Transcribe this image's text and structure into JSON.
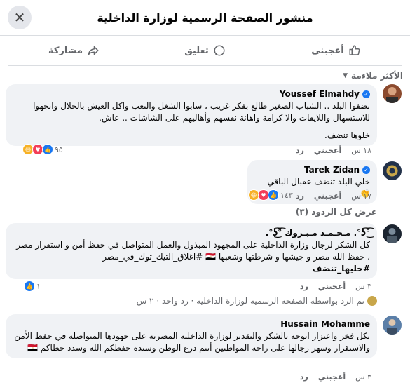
{
  "header": {
    "title": "منشور الصفحة الرسمية لوزارة الداخلية",
    "close_symbol": "✕"
  },
  "actions": {
    "like": "أعجبني",
    "comment": "تعليق",
    "share": "مشاركة"
  },
  "sort": {
    "label": "الأكثر ملاءمة"
  },
  "comments": [
    {
      "name": "Youssef Elmahdy",
      "text1": "تضفوا البلد .. الشباب الصغير طالع بفكر غريب ، سابوا الشغل والتعب واكل العيش بالحلال واتجهوا للاستسهال واللايفات والا كرامة واهانة نفسهم وأهاليهم على الشاشات .. عاش.",
      "text2": "خلوها تنضف.",
      "time": "١٨ س",
      "like": "أعجبني",
      "reply": "رد",
      "reaction_count": "٩٥"
    },
    {
      "name": "Tarek Zidan",
      "text1": "خلي البلد تنضف عقبال الباقي 👏",
      "time": "١٧ س",
      "like": "أعجبني",
      "reply": "رد",
      "reaction_count": "١٤٣"
    },
    {
      "name": "͡°͜ʖ͡°. مـحـمـد مـبـروك ͡°͜ʖ͡°.",
      "text1": "كل الشكر لرجال وزارة الداخلية على المجهود المبذول والعمل المتواصل في حفظ أمن و استقرار مصر ، حفظ الله مصر و جيشها و شرطتها وشعبها 🇪🇬 #اغلاق_التيك_توك_في_مصر",
      "text2": "#خليها_تنضف",
      "time": "٣ س",
      "like": "أعجبني",
      "reply": "رد",
      "reaction_count": "١"
    },
    {
      "name": "Hussain Mohamme",
      "text1": "بكل فخر واعتزاز اتوجه بالشكر والتقدير لوزارة الداخلية المصرية على جهودها المتواصلة في حفظ الأمن والاستقرار وسهر رجالها على راحة المواطنين أنتم درع الوطن وسنده حفظكم الله وسدد خطاكم 🇪🇬",
      "time": "٣ س",
      "like": "أعجبني",
      "reply": "رد"
    }
  ],
  "view_all_replies": "عرض كل الردود (٣)",
  "page_reply": "تم الرد بواسطة الصفحة الرسمية لوزارة الداخلية · رد واحد · ٢ س"
}
